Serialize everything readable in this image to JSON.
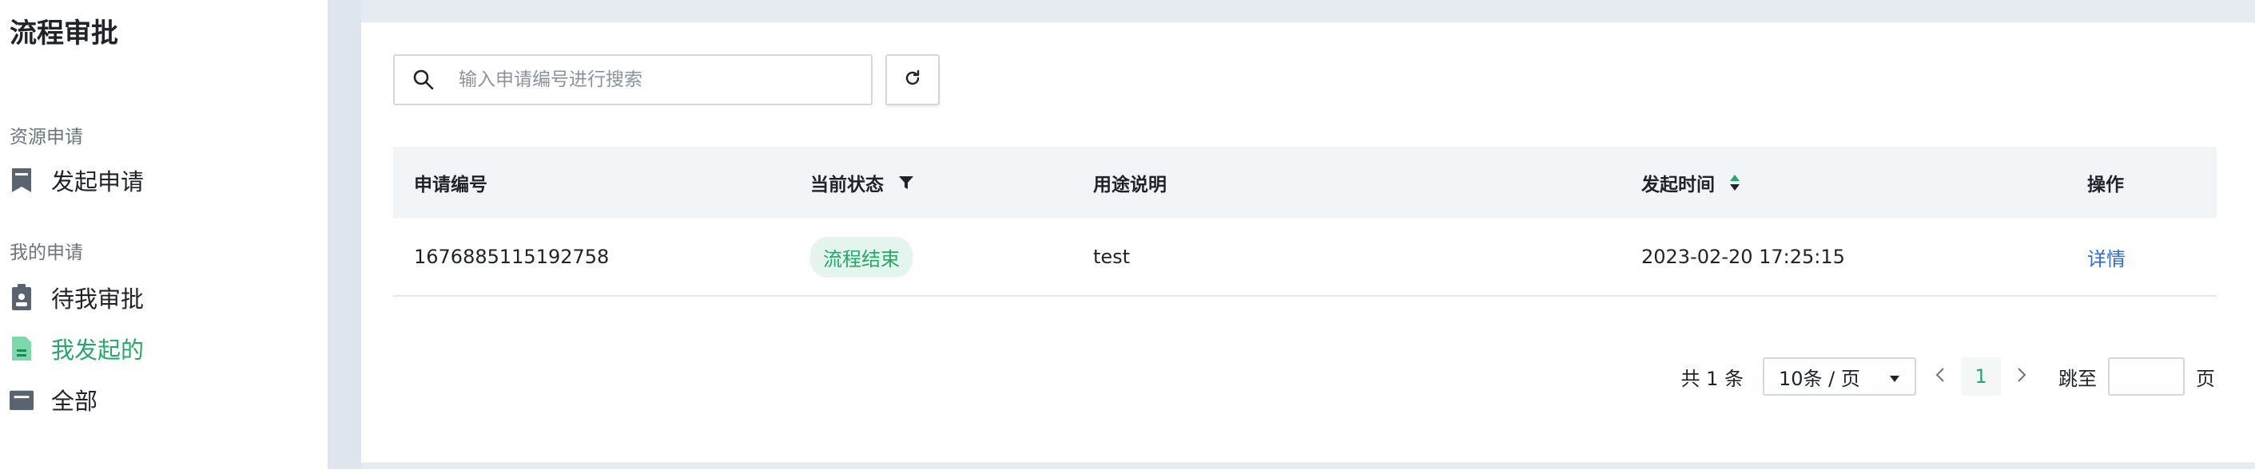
{
  "sidebar": {
    "title": "流程审批",
    "groups": [
      {
        "title": "资源申请",
        "items": [
          {
            "label": "发起申请",
            "icon": "bookmark-icon"
          }
        ]
      },
      {
        "title": "我的申请",
        "items": [
          {
            "label": "待我审批",
            "icon": "clipboard-user-icon"
          },
          {
            "label": "我发起的",
            "icon": "document-icon",
            "active": true
          },
          {
            "label": "全部",
            "icon": "folder-icon"
          }
        ]
      }
    ]
  },
  "search": {
    "placeholder": "输入申请编号进行搜索",
    "value": ""
  },
  "table": {
    "headers": [
      "申请编号",
      "当前状态",
      "用途说明",
      "发起时间",
      "操作"
    ],
    "rows": [
      {
        "id": "1676885115192758",
        "status": "流程结束",
        "purpose": "test",
        "time": "2023-02-20 17:25:15",
        "action": "详情"
      }
    ]
  },
  "pagination": {
    "total_text": "共 1 条",
    "page_size": "10条 / 页",
    "current_page": "1",
    "jump_label": "跳至",
    "page_suffix": "页"
  },
  "colors": {
    "accent": "#27a86b",
    "link": "#2f6bd8",
    "background": "#e6ebf1"
  }
}
